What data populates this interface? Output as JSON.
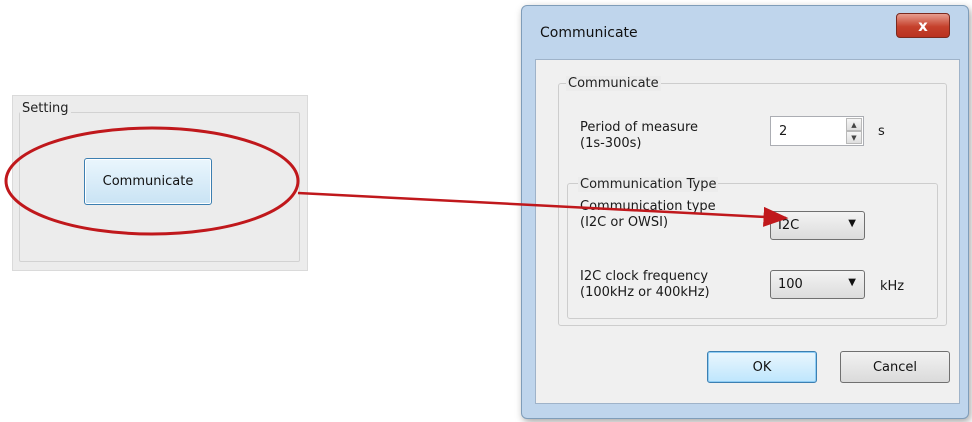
{
  "setting_panel": {
    "group_label": "Setting",
    "button_label": "Communicate"
  },
  "dialog": {
    "title": "Communicate",
    "close_glyph": "x",
    "group_label": "Communicate",
    "period": {
      "label": "Period of measure\n(1s-300s)",
      "value": "2",
      "unit": "s"
    },
    "comm_type_group": {
      "label": "Communication Type",
      "type_label": "Communication type\n(I2C or OWSI)",
      "type_value": "I2C",
      "freq_label": "I2C clock frequency\n(100kHz or 400kHz)",
      "freq_value": "100",
      "freq_unit": "kHz"
    },
    "ok_label": "OK",
    "cancel_label": "Cancel"
  },
  "annotation": {
    "color": "#c0181c"
  },
  "icons": [
    "close-icon",
    "spin-up-icon",
    "spin-down-icon",
    "dropdown-arrow-icon"
  ]
}
